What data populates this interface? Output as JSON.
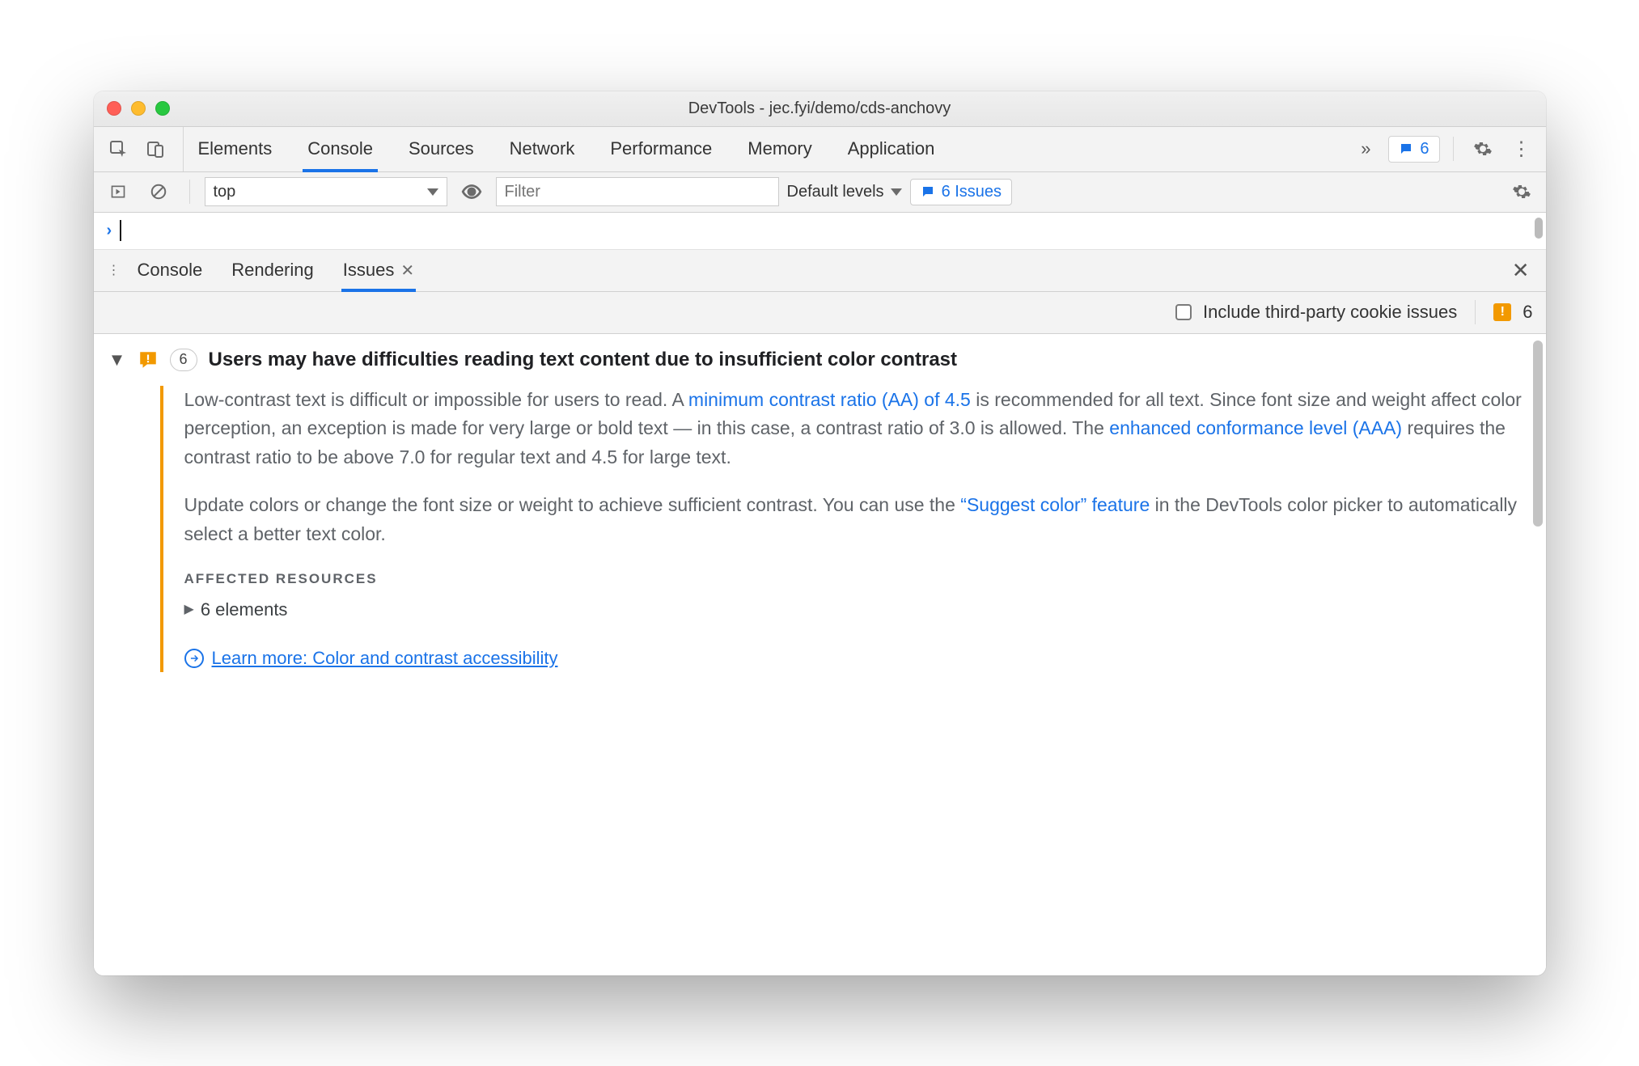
{
  "window": {
    "title": "DevTools - jec.fyi/demo/cds-anchovy"
  },
  "tabs": {
    "items": [
      "Elements",
      "Console",
      "Sources",
      "Network",
      "Performance",
      "Memory",
      "Application"
    ],
    "active_index": 1,
    "issues_badge": "6"
  },
  "console_toolbar": {
    "context": "top",
    "filter_placeholder": "Filter",
    "levels_label": "Default levels",
    "issues_link": "6 Issues"
  },
  "drawer": {
    "tabs": [
      "Console",
      "Rendering",
      "Issues"
    ],
    "active_index": 2
  },
  "issues_toolbar": {
    "checkbox_label": "Include third-party cookie issues",
    "total_count": "6"
  },
  "issue": {
    "count": "6",
    "title": "Users may have difficulties reading text content due to insufficient color contrast",
    "p1a": "Low-contrast text is difficult or impossible for users to read. A ",
    "link1": "minimum contrast ratio (AA) of 4.5",
    "p1b": " is recommended for all text. Since font size and weight affect color perception, an exception is made for very large or bold text — in this case, a contrast ratio of 3.0 is allowed. The ",
    "link2": "enhanced conformance level (AAA)",
    "p1c": " requires the contrast ratio to be above 7.0 for regular text and 4.5 for large text.",
    "p2a": "Update colors or change the font size or weight to achieve sufficient contrast. You can use the ",
    "link3": "“Suggest color” feature",
    "p2b": " in the DevTools color picker to automatically select a better text color.",
    "affected_label": "AFFECTED RESOURCES",
    "affected_elements": "6 elements",
    "learn_more": "Learn more: Color and contrast accessibility"
  }
}
